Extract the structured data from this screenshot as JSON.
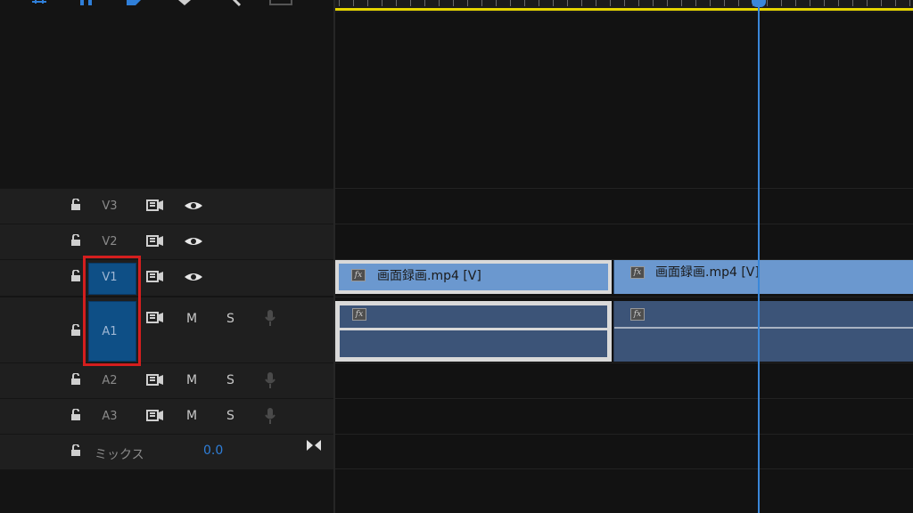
{
  "tracks": {
    "video": [
      {
        "label": "V3"
      },
      {
        "label": "V2"
      },
      {
        "label": "V1"
      }
    ],
    "audio": [
      {
        "label": "A1",
        "mute": "M",
        "solo": "S"
      },
      {
        "label": "A2",
        "mute": "M",
        "solo": "S"
      },
      {
        "label": "A3",
        "mute": "M",
        "solo": "S"
      }
    ],
    "mix": {
      "label": "ミックス",
      "value": "0.0"
    }
  },
  "clips": {
    "video": [
      {
        "label": "画面録画.mp4 [V]",
        "fx": "fx"
      },
      {
        "label": "画面録画.mp4 [V]",
        "fx": "fx"
      }
    ],
    "audio": [
      {
        "fx": "fx"
      },
      {
        "fx": "fx"
      }
    ]
  },
  "colors": {
    "video_clip": "#6b98cf",
    "audio_clip": "#3c5478",
    "target_active": "#0e4f86",
    "playhead": "#3a87d9",
    "work_area_bar": "#e6d500",
    "annotation_box": "#d41e1e",
    "mix_value": "#2f7fd9"
  },
  "icons": [
    "lock-icon",
    "sync-lock-icon",
    "eye-icon",
    "microphone-icon",
    "mix-collapse-icon",
    "playhead-marker-icon",
    "fx-badge-icon"
  ]
}
